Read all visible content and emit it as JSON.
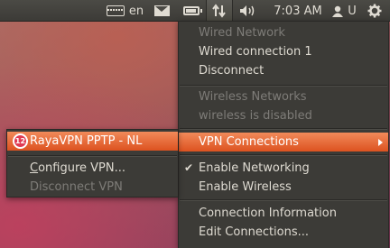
{
  "panel": {
    "keyboard_layout": "en",
    "time": "7:03 AM",
    "user": "U",
    "icons": [
      "keyboard-icon",
      "mail-icon",
      "battery-icon",
      "network-icon",
      "volume-icon",
      "user-icon",
      "gear-icon"
    ]
  },
  "network_menu": {
    "wired_header": "Wired Network",
    "wired_connection": "Wired connection 1",
    "disconnect": "Disconnect",
    "wireless_header": "Wireless Networks",
    "wireless_disabled": "wireless is disabled",
    "vpn_connections": "VPN Connections",
    "enable_networking": "Enable Networking",
    "enable_wireless": "Enable Wireless",
    "connection_info": "Connection Information",
    "edit_connections": "Edit Connections..."
  },
  "vpn_submenu": {
    "vpn_badge": "12",
    "vpn_name": "RayaVPN PPTP - NL",
    "configure_prefix": "C",
    "configure_rest": "onfigure VPN...",
    "disconnect_vpn": "Disconnect VPN"
  },
  "colors": {
    "highlight": "#dd5220",
    "menu_bg": "#3c3b37",
    "panel_bg": "#3c3b37"
  }
}
